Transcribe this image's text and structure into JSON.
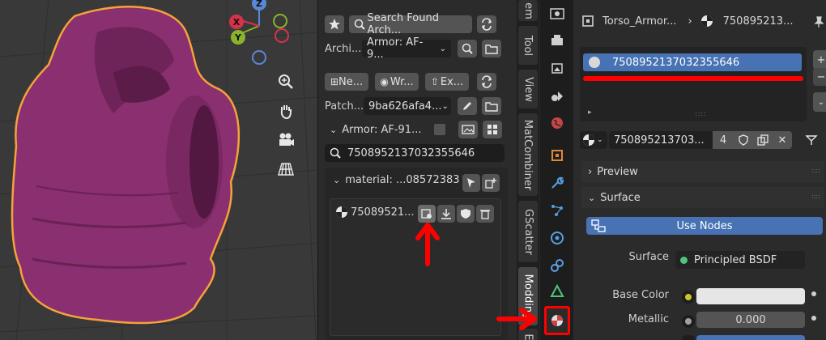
{
  "viewport": {
    "gizmo": {
      "x": "X",
      "y": "Y",
      "z": "Z"
    },
    "object_color": "#8a2f6f",
    "outline_color": "#f6a23a"
  },
  "npanel": {
    "search_found_label": "Search Found Arch...",
    "archive_label": "Archi...",
    "archive_value": "Armor: AF-9...",
    "new_button": "Ne...",
    "write_button": "Wr...",
    "export_button": "Ex...",
    "patch_label": "Patch...",
    "patch_value": "9ba626afa4...",
    "armor_section": "Armor: AF-91...",
    "search_value": "7508952137032355646",
    "material_label": "material: ...08572383",
    "material_item": "75089521..."
  },
  "vtabs": {
    "item": "em",
    "tool": "Tool",
    "view": "View",
    "matcombiner": "MatCombiner",
    "gscatter": "GScatter",
    "modding": "Modding",
    "extra": "E"
  },
  "props": {
    "breadcrumb_object": "Torso_Armor...",
    "breadcrumb_material": "750895213...",
    "slot_name": "7508952137032355646",
    "material_name": "750895213703...",
    "user_count": "4",
    "preview_label": "Preview",
    "surface_label": "Surface",
    "use_nodes_label": "Use Nodes",
    "surface_field_label": "Surface",
    "surface_shader": "Principled BSDF",
    "base_color_label": "Base Color",
    "metallic_label": "Metallic",
    "metallic_value": "0.000",
    "base_color": "#e6e6e6",
    "accent": "#4772b3"
  },
  "annotations": {
    "color": "#ff0000"
  }
}
